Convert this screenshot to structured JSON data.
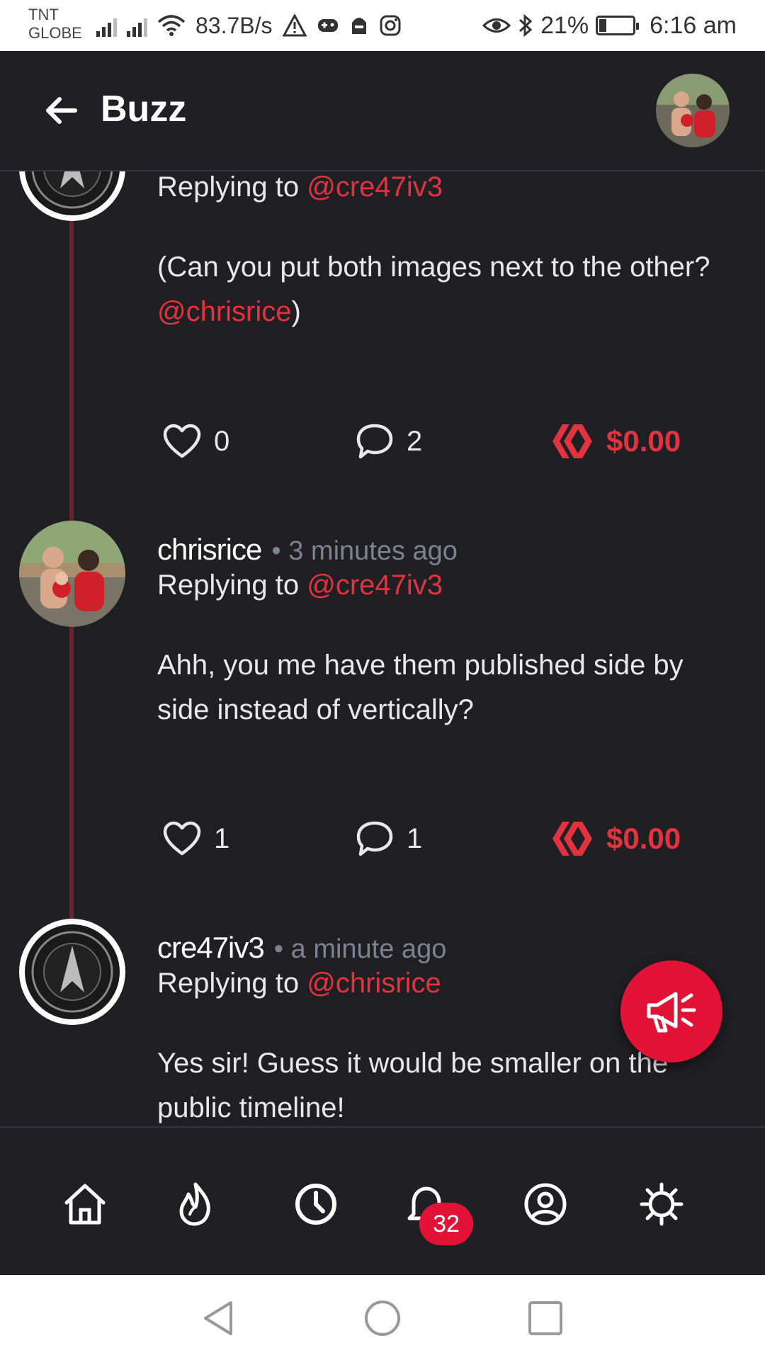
{
  "status_bar": {
    "carrier_line1": "TNT",
    "carrier_line2": "GLOBE",
    "net_speed": "83.7B/s",
    "battery_text": "21%",
    "battery_level": 0.21,
    "time": "6:16 am",
    "icons": [
      "signal-icon",
      "signal-icon",
      "wifi-icon",
      "warning-icon",
      "game-icon",
      "app-icon",
      "instagram-icon",
      "eye-icon",
      "bluetooth-icon",
      "battery-icon"
    ]
  },
  "header": {
    "title": "Buzz",
    "back_icon": "arrow-left-icon"
  },
  "posts": [
    {
      "username": "",
      "time": "",
      "replying_label": "Replying to ",
      "replying_to": "@cre47iv3",
      "body_text": "(Can you put both images next to the other? ",
      "body_mention": "@chrisrice",
      "body_suffix": ")",
      "likes": "0",
      "comments": "2",
      "payout": "$0.00"
    },
    {
      "username": "chrisrice",
      "time": "• 3 minutes ago",
      "replying_label": "Replying to ",
      "replying_to": "@cre47iv3",
      "body_text": "Ahh, you me have them published side by side instead of vertically?",
      "likes": "1",
      "comments": "1",
      "payout": "$0.00"
    },
    {
      "username": "cre47iv3",
      "time": "• a minute ago",
      "replying_label": "Replying to ",
      "replying_to": "@chrisrice",
      "body_text": "Yes sir! Guess it would be smaller on the public timeline!"
    }
  ],
  "fab": {
    "icon": "megaphone-icon"
  },
  "bottom_nav": {
    "items": [
      "home-icon",
      "flame-icon",
      "clock-icon",
      "bell-icon",
      "profile-icon",
      "settings-icon"
    ],
    "notification_count": "32"
  },
  "colors": {
    "background": "#1f1f24",
    "accent": "#e31337",
    "mention": "#e2333f",
    "thread_line": "#6b2228"
  }
}
